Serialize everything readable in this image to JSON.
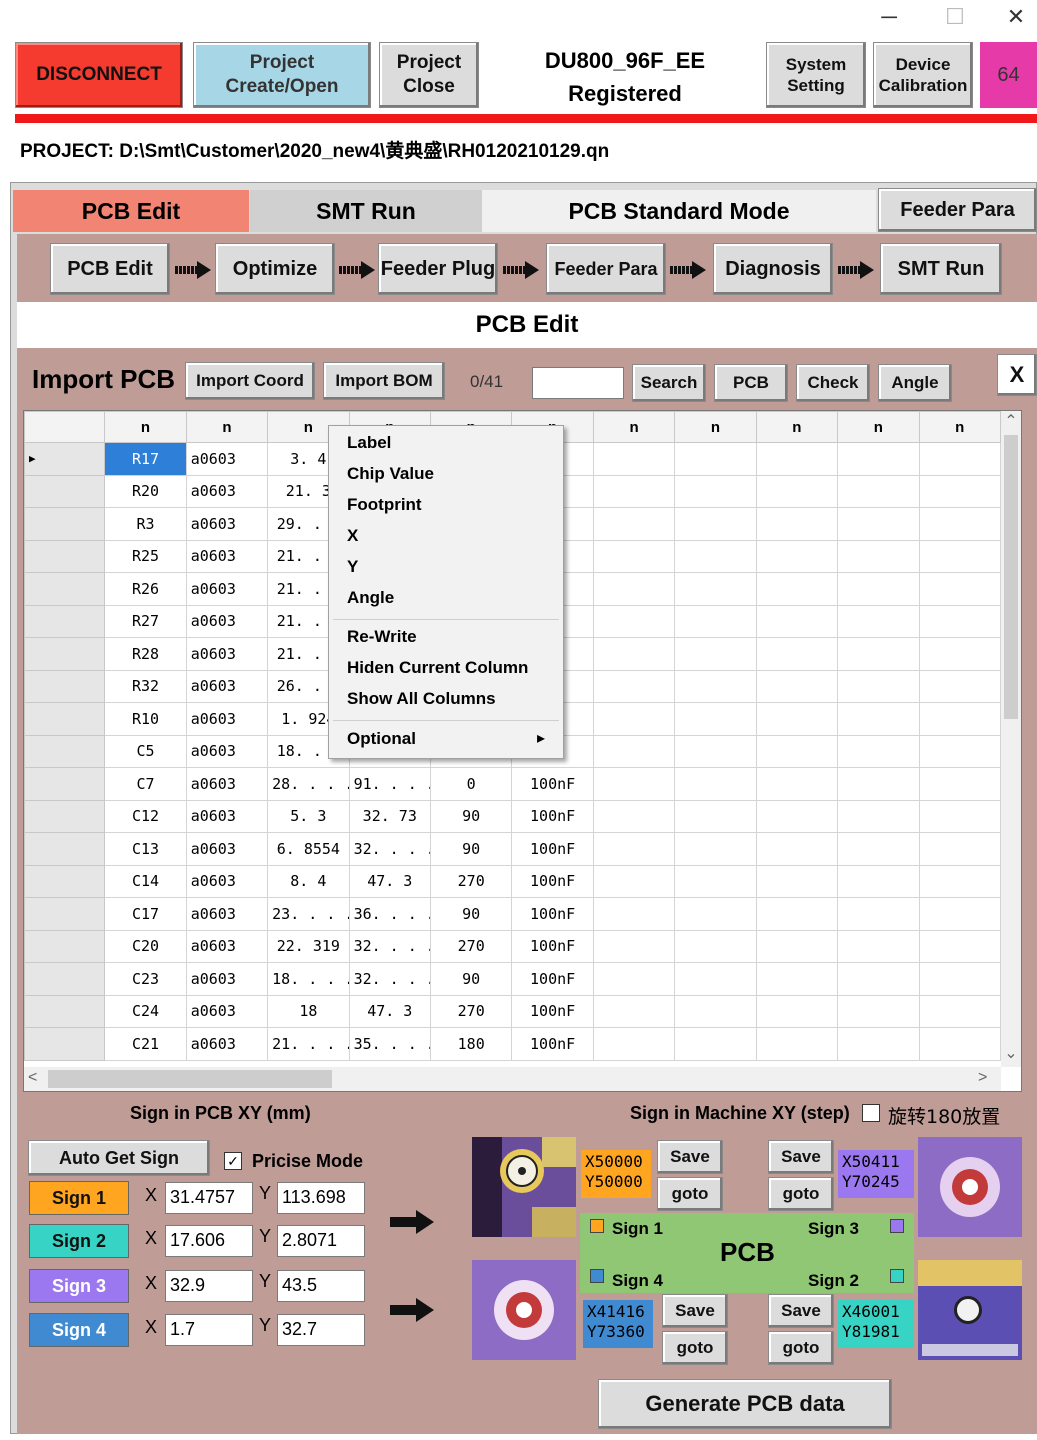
{
  "window": {
    "minimize": "─",
    "maximize": "☐",
    "close": "✕"
  },
  "toolbar": {
    "disconnect": "DISCONNECT",
    "project_create": "Project\nCreate/Open",
    "project_close": "Project\nClose",
    "machine_line1": "DU800_96F_EE",
    "machine_line2": "Registered",
    "system_setting": "System\nSetting",
    "device_calibration": "Device\nCalibration",
    "badge": "64"
  },
  "project_path": "PROJECT: D:\\Smt\\Customer\\2020_new4\\黄典盛\\RH0120210129.qn",
  "tabs": [
    "PCB Edit",
    "SMT Run",
    "PCB Standard Mode",
    "Feeder Para"
  ],
  "workflow": [
    "PCB Edit",
    "Optimize",
    "Feeder Plug",
    "Feeder Para",
    "Diagnosis",
    "SMT Run"
  ],
  "section_title": "PCB Edit",
  "import": {
    "title": "Import PCB",
    "import_coord": "Import Coord",
    "import_bom": "Import BOM",
    "count": "0/41",
    "search_value": "",
    "search": "Search",
    "pcb": "PCB",
    "check": "Check",
    "angle": "Angle",
    "close": "X"
  },
  "table": {
    "headers": [
      "n",
      "n",
      "n",
      "n",
      "n",
      "n",
      "n",
      "n",
      "n",
      "n",
      "n",
      "n"
    ],
    "rows": [
      [
        "R17",
        "a0603",
        "3. 4",
        "",
        "",
        ""
      ],
      [
        "R20",
        "a0603",
        "21. 3",
        "",
        "",
        ""
      ],
      [
        "R3",
        "a0603",
        "29. . .",
        "",
        "",
        ""
      ],
      [
        "R25",
        "a0603",
        "21. . .",
        "",
        "",
        ""
      ],
      [
        "R26",
        "a0603",
        "21. . .",
        "",
        "",
        ""
      ],
      [
        "R27",
        "a0603",
        "21. . .",
        "",
        "",
        ""
      ],
      [
        "R28",
        "a0603",
        "21. . .",
        "",
        "",
        ""
      ],
      [
        "R32",
        "a0603",
        "26. . .",
        "",
        "",
        ""
      ],
      [
        "R10",
        "a0603",
        "1. 924",
        "",
        "",
        ""
      ],
      [
        "C5",
        "a0603",
        "18. . .",
        "",
        "",
        ""
      ],
      [
        "C7",
        "a0603",
        "28. . . .",
        "91. . . .",
        "0",
        "100nF"
      ],
      [
        "C12",
        "a0603",
        "5. 3",
        "32. 73",
        "90",
        "100nF"
      ],
      [
        "C13",
        "a0603",
        "6. 8554",
        "32. . . .",
        "90",
        "100nF"
      ],
      [
        "C14",
        "a0603",
        "8. 4",
        "47. 3",
        "270",
        "100nF"
      ],
      [
        "C17",
        "a0603",
        "23. . . .",
        "36. . . .",
        "90",
        "100nF"
      ],
      [
        "C20",
        "a0603",
        "22. 319",
        "32. . . .",
        "270",
        "100nF"
      ],
      [
        "C23",
        "a0603",
        "18. . . .",
        "32. . . .",
        "90",
        "100nF"
      ],
      [
        "C24",
        "a0603",
        "18",
        "47. 3",
        "270",
        "100nF"
      ],
      [
        "C21",
        "a0603",
        "21. . . .",
        "35. . . .",
        "180",
        "100nF"
      ]
    ],
    "scroll_up": "⌃",
    "scroll_down": "⌄",
    "scroll_left": "<",
    "scroll_right": ">",
    "row_pointer": "▶"
  },
  "context_menu": {
    "group1": [
      "Label",
      "Chip Value",
      "Footprint",
      "X",
      "Y",
      "Angle"
    ],
    "group2": [
      "Re-Write",
      "Hiden Current Column",
      "Show All Columns"
    ],
    "optional": "Optional",
    "submenu_arrow": "▸"
  },
  "sign": {
    "pcb_title": "Sign in PCB XY (mm)",
    "machine_title": "Sign in Machine XY (step)",
    "rotate_label": "旋转180放置",
    "rotate_checked": false,
    "auto_get": "Auto Get Sign",
    "precise_label": "Pricise Mode",
    "precise_checked": true,
    "check_mark": "✓",
    "x_label": "X",
    "y_label": "Y",
    "signs": [
      {
        "label": "Sign 1",
        "x": "31.4757",
        "y": "113.698",
        "color": "#ffa51f"
      },
      {
        "label": "Sign 2",
        "x": "17.606",
        "y": "2.8071",
        "color": "#37d4c6"
      },
      {
        "label": "Sign 3",
        "x": "32.9",
        "y": "43.5",
        "color": "#9b78f0"
      },
      {
        "label": "Sign 4",
        "x": "1.7",
        "y": "32.7",
        "color": "#3f8ad1"
      }
    ],
    "machine": {
      "s1": {
        "x": "X50000",
        "y": "Y50000"
      },
      "s3": {
        "x": "X50411",
        "y": "Y70245"
      },
      "s4": {
        "x": "X41416",
        "y": "Y73360"
      },
      "s2": {
        "x": "X46001",
        "y": "Y81981"
      }
    },
    "save": "Save",
    "goto": "goto",
    "board_label": "PCB",
    "board_sign1": "Sign 1",
    "board_sign2": "Sign 2",
    "board_sign3": "Sign 3",
    "board_sign4": "Sign 4"
  },
  "generate": "Generate PCB data",
  "colors": {
    "disconnect": "#f53a2f",
    "project_btn": "#a7d7e6",
    "panel": "#c09c96",
    "tab_active": "#f28474",
    "badge": "#e63aa8",
    "board": "#8fc774"
  }
}
